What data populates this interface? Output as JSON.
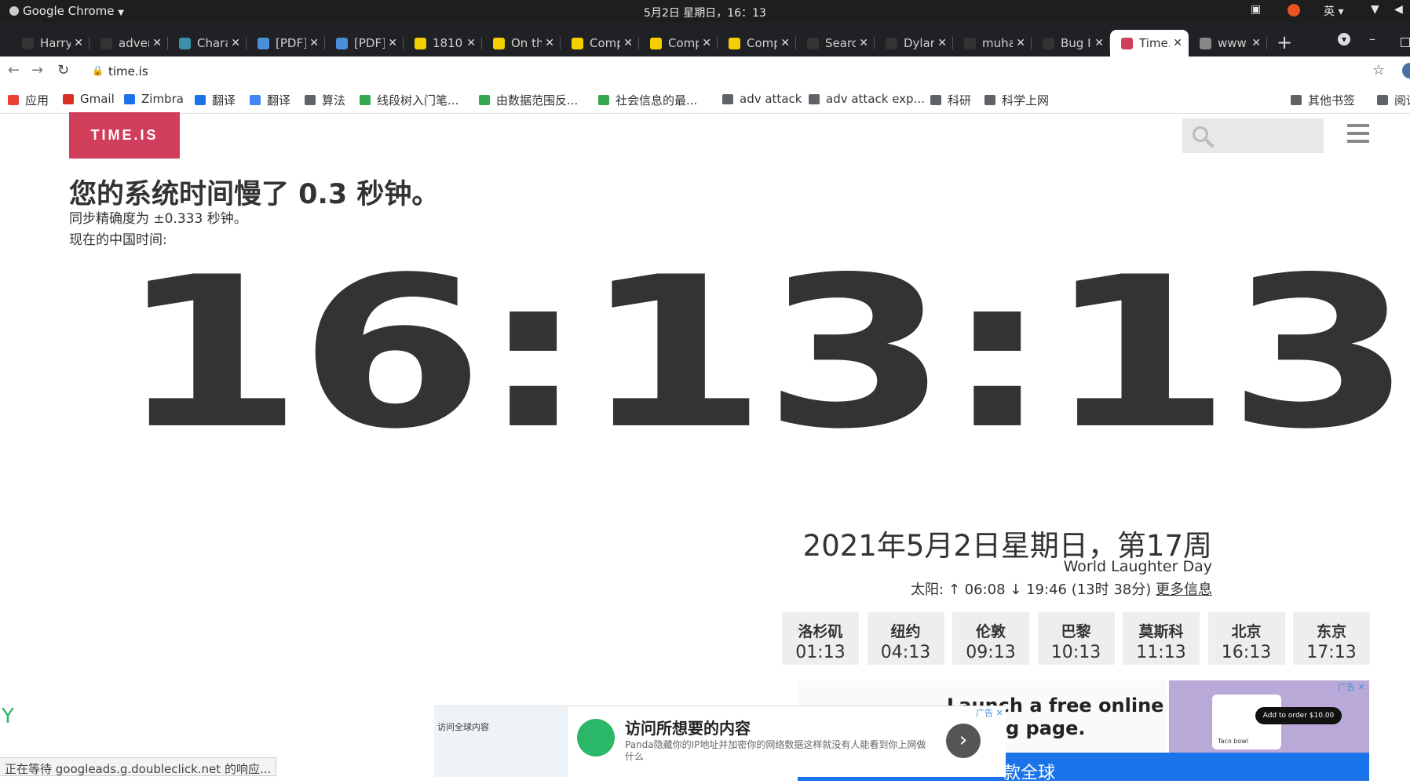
{
  "os": {
    "app_name": "Google Chrome",
    "clock": "5月2日 星期日，16：13",
    "ime": "英"
  },
  "tabs": [
    {
      "title": "Harry",
      "color": "#333"
    },
    {
      "title": "adver",
      "color": "#333"
    },
    {
      "title": "Chara",
      "color": "#3c8fa8"
    },
    {
      "title": "[PDF]",
      "color": "#4a90d9"
    },
    {
      "title": "[PDF]",
      "color": "#4a90d9"
    },
    {
      "title": "1810.",
      "color": "#f5d000"
    },
    {
      "title": "On th",
      "color": "#f5d000"
    },
    {
      "title": "Comp",
      "color": "#f5d000"
    },
    {
      "title": "Comp",
      "color": "#f5d000"
    },
    {
      "title": "Comp",
      "color": "#f5d000"
    },
    {
      "title": "Searc",
      "color": "#333"
    },
    {
      "title": "Dylar",
      "color": "#333"
    },
    {
      "title": "muha",
      "color": "#333"
    },
    {
      "title": "Bug I",
      "color": "#333"
    },
    {
      "title": "Time.",
      "color": "#d13e5b"
    },
    {
      "title": "www",
      "color": "#888"
    }
  ],
  "active_tab_index": 14,
  "address": {
    "url": "time.is"
  },
  "bookmarks": [
    {
      "label": "应用",
      "icon": "apps-grid"
    },
    {
      "label": "Gmail",
      "icon": "gmail"
    },
    {
      "label": "Zimbra",
      "icon": "zimbra"
    },
    {
      "label": "翻译",
      "icon": "translate"
    },
    {
      "label": "翻译",
      "icon": "google-translate"
    },
    {
      "label": "算法",
      "icon": "folder"
    },
    {
      "label": "线段树入门笔...",
      "icon": "site"
    },
    {
      "label": "由数据范围反...",
      "icon": "site"
    },
    {
      "label": "社会信息的最...",
      "icon": "site"
    },
    {
      "label": "adv attack",
      "icon": "folder"
    },
    {
      "label": "adv attack exp...",
      "icon": "folder"
    },
    {
      "label": "科研",
      "icon": "folder"
    },
    {
      "label": "科学上网",
      "icon": "folder"
    },
    {
      "label": "其他书签",
      "icon": "folder"
    },
    {
      "label": "阅读",
      "icon": "reading-list"
    }
  ],
  "page": {
    "logo": "TIME.IS",
    "headline": "您的系统时间慢了 0.3 秒钟。",
    "sync_accuracy": "同步精确度为 ±0.333 秒钟。",
    "local_label": "现在的中国时间:",
    "clock": "16:13:13",
    "date": "2021年5月2日星期日，第17周",
    "holiday": "World Laughter Day",
    "sun_label": "太阳:",
    "sunrise": "↑ 06:08",
    "sunset": "↓ 19:46",
    "daylength": "(13时 38分)",
    "more_info": "更多信息",
    "cities": [
      {
        "name": "洛杉矶",
        "time": "01:13"
      },
      {
        "name": "纽约",
        "time": "04:13"
      },
      {
        "name": "伦敦",
        "time": "09:13"
      },
      {
        "name": "巴黎",
        "time": "10:13"
      },
      {
        "name": "莫斯科",
        "time": "11:13"
      },
      {
        "name": "北京",
        "time": "16:13"
      },
      {
        "name": "东京",
        "time": "17:13"
      }
    ]
  },
  "ads": {
    "ad_right_line1": "Launch a free online",
    "ad_right_line2": "g page.",
    "ad_right_btn": "Add to order",
    "ad_right_price": "$10.00",
    "ad_right_item": "Taco bowl",
    "ad_right_bottom": "款全球",
    "ad_left_small": "访问全球内容",
    "ad_left_title": "访问所想要的内容",
    "ad_left_body": "Panda隐藏你的IP地址并加密你的网络数据这样就没有人能看到你上网做什么",
    "ad_badge": "广告"
  },
  "status": "正在等待 googleads.g.doubleclick.net 的响应..."
}
